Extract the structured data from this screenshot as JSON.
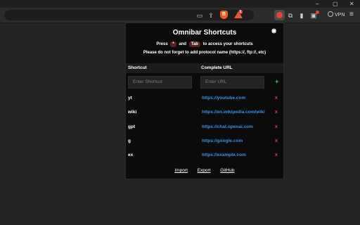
{
  "window": {
    "minimize": "–",
    "maximize": "▢",
    "close": "✕"
  },
  "toolbar": {
    "cast": "▭",
    "share": "⇪",
    "brave_shield": "B",
    "brave_badge": "1",
    "extensions": "⧉",
    "sidebar": "▮",
    "wallet": "▣",
    "vpn_label": "VPN",
    "menu": "≡"
  },
  "popup": {
    "title": "Omnibar Shortcuts",
    "settings_icon": "✸",
    "instruction_press": "Press",
    "key1": "*",
    "instruction_and": "and",
    "key2": "Tab",
    "instruction_rest": "to access your shortcuts",
    "note": "Please do not forget to add protocol name (https://, ftp://, etc)",
    "headers": {
      "shortcut": "Shortcut",
      "url": "Complete URL"
    },
    "shortcut_placeholder": "Enter Shortcut",
    "url_placeholder": "Enter URL",
    "add_label": "+",
    "delete_label": "x",
    "shortcuts": [
      {
        "key": "yt",
        "url": "https://youtube.com"
      },
      {
        "key": "wiki",
        "url": "https://en.wikipedia.com/wiki"
      },
      {
        "key": "gpt",
        "url": "https://chat.openai.com"
      },
      {
        "key": "g",
        "url": "https://google.com"
      },
      {
        "key": "ex",
        "url": "https://example.com"
      }
    ],
    "footer": {
      "import": "Import",
      "export": "Export",
      "github": "GitHub"
    }
  }
}
